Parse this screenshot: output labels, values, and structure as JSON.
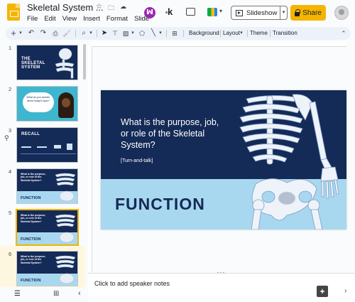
{
  "app": {
    "title": "Skeletal System ...",
    "menu": [
      "File",
      "Edit",
      "View",
      "Insert",
      "Format",
      "Slide"
    ],
    "slideshow_label": "Slideshow",
    "share_label": "Share",
    "brand_color": "#f4b400",
    "k_label": "k"
  },
  "toolbar": {
    "background_label": "Background",
    "layout_label": "Layout",
    "theme_label": "Theme",
    "transition_label": "Transition"
  },
  "filmstrip": {
    "slides": [
      {
        "number": "1",
        "title": "THE SKELETAL SYSTEM"
      },
      {
        "number": "2",
        "text": "What do you wonder about today's topic?"
      },
      {
        "number": "3",
        "title": "RECALL"
      },
      {
        "number": "4",
        "question": "What is the purpose, job, or role of the Skeletal System?",
        "title": "FUNCTION"
      },
      {
        "number": "5",
        "question": "What is the purpose, job, or role of the Skeletal System?",
        "title": "FUNCTION"
      },
      {
        "number": "6",
        "question": "What is the purpose, job, or role of the Skeletal System?",
        "title": "FUNCTION"
      }
    ],
    "selected": 5
  },
  "slide": {
    "question": "What is the purpose, job, or role of the Skeletal System?",
    "prompt": "[Turn-and-talk]",
    "heading": "FUNCTION",
    "dark_color": "#142a57",
    "light_color": "#a8d8ef"
  },
  "notes": {
    "placeholder": "Click to add speaker notes"
  }
}
